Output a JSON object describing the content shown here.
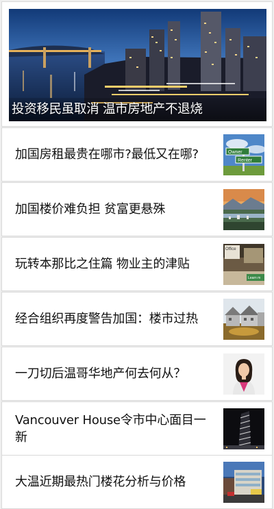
{
  "hero": {
    "title": "投资移民虽取消 温市房地产不退烧",
    "image": "vancouver-night-skyline"
  },
  "articles": [
    {
      "title": "加国房租最贵在哪市?最低又在哪?",
      "thumb": "owner-renter-sign",
      "thumb_text": [
        "Owner",
        "Renter"
      ]
    },
    {
      "title": "加国楼价难负担 贫富更悬殊",
      "thumb": "city-mountain-landscape"
    },
    {
      "title": "玩转本那比之住篇 物业主的津贴",
      "thumb": "office-interior",
      "thumb_text": [
        "Office",
        "Learn m"
      ]
    },
    {
      "title": "经合组织再度警告加国：楼市过热",
      "thumb": "suburban-houses"
    },
    {
      "title": "一刀切后温哥华地产何去何从？",
      "thumb": "realtor-portrait"
    },
    {
      "title": "Vancouver House令市中心面目一新",
      "thumb": "vancouver-house-tower"
    },
    {
      "title": "大温近期最热门楼花分析与价格",
      "thumb": "condo-building-street"
    }
  ]
}
